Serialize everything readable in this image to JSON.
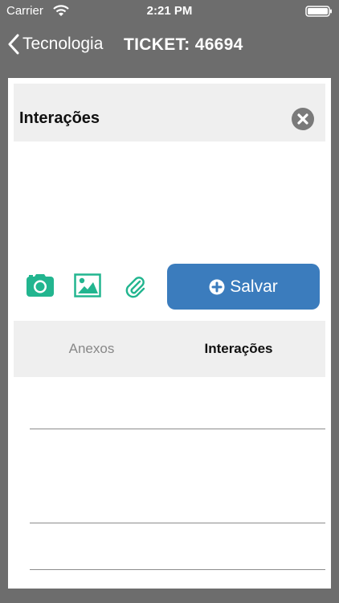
{
  "statusbar": {
    "carrier": "Carrier",
    "time": "2:21 PM"
  },
  "navbar": {
    "back_label": "Tecnologia",
    "title": "TICKET: 46694"
  },
  "modal": {
    "title": "Interações",
    "save_label": "Salvar"
  },
  "tabs": [
    {
      "label": "Anexos",
      "selected": false
    },
    {
      "label": "Interações",
      "selected": true
    }
  ],
  "colors": {
    "accent_green": "#22b58f",
    "button_blue": "#3b7cbd",
    "nav_gray": "#6d6d6d"
  }
}
